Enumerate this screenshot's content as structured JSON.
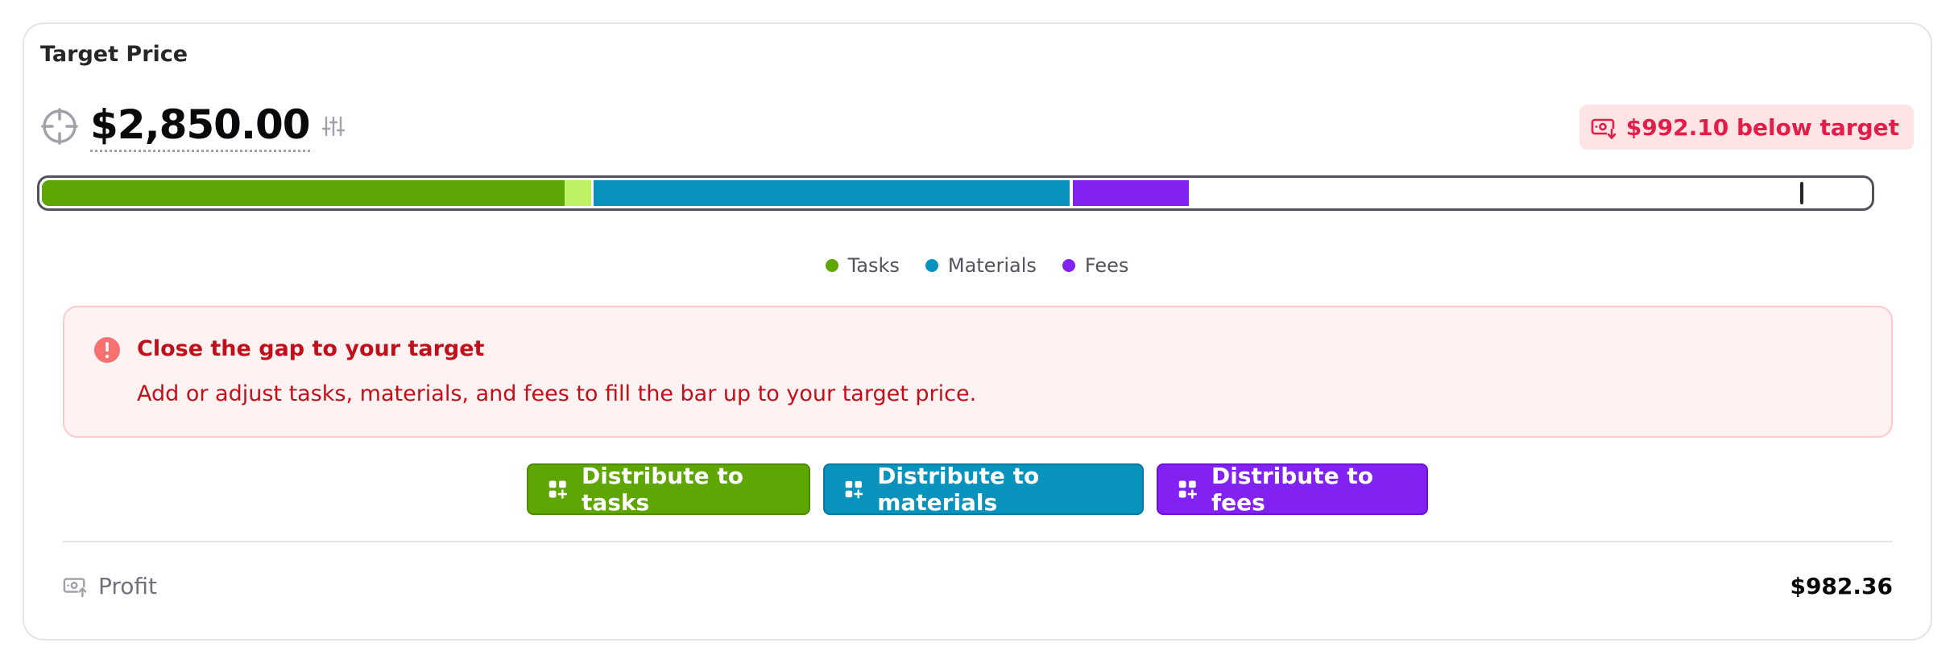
{
  "target_price": {
    "label": "Target Price",
    "value": "$2,850.00",
    "badge_text": "$992.10 below target"
  },
  "colors": {
    "tasks": "#5da603",
    "tasks_light": "#bef264",
    "materials": "#0893bd",
    "fees": "#8222f2"
  },
  "progress_bar": {
    "segments": [
      {
        "key": "tasks",
        "fraction": 0.286,
        "color": "#5da603"
      },
      {
        "key": "tasks_extra",
        "fraction": 0.0145,
        "color": "#bef264"
      },
      {
        "key": "materials",
        "fraction": 0.262,
        "color": "#0893bd"
      },
      {
        "key": "fees",
        "fraction": 0.065,
        "color": "#8222f2"
      }
    ],
    "target_marker_fraction": 0.962
  },
  "legend": [
    {
      "label": "Tasks",
      "color": "#5da603"
    },
    {
      "label": "Materials",
      "color": "#0893bd"
    },
    {
      "label": "Fees",
      "color": "#8222f2"
    }
  ],
  "alert": {
    "title": "Close the gap to your target",
    "body": "Add or adjust tasks, materials, and fees to fill the bar up to your target price."
  },
  "actions": {
    "tasks": "Distribute to tasks",
    "materials": "Distribute to materials",
    "fees": "Distribute to fees"
  },
  "profit": {
    "label": "Profit",
    "value": "$982.36"
  },
  "icons": {
    "target": "crosshair-icon",
    "adjust": "sliders-icon",
    "badge": "money-down-icon",
    "alert": "alert-circle-icon",
    "distribute": "grid-plus-icon",
    "profit": "money-up-icon"
  }
}
